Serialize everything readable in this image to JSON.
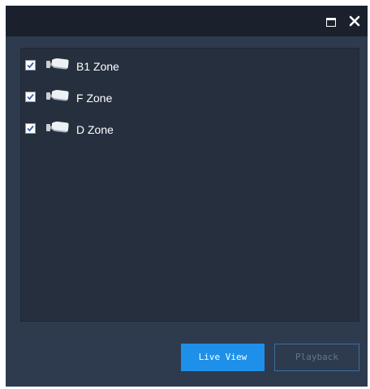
{
  "window": {
    "controls": {
      "maximize_icon": "maximize-icon",
      "close_icon": "close-icon"
    }
  },
  "zones": [
    {
      "label": "B1 Zone",
      "checked": true,
      "icon": "camera-icon"
    },
    {
      "label": "F Zone",
      "checked": true,
      "icon": "camera-icon"
    },
    {
      "label": "D Zone",
      "checked": true,
      "icon": "camera-icon"
    }
  ],
  "buttons": {
    "live_view": "Live View",
    "playback": "Playback"
  },
  "colors": {
    "dialog_bg": "#2e3a4d",
    "titlebar_bg": "#1a212d",
    "panel_bg": "#262f3e",
    "accent": "#1e90ea",
    "disabled_border": "#3a6fa3",
    "disabled_text": "#5a7a9c",
    "checkmark": "#3d5fa8"
  }
}
